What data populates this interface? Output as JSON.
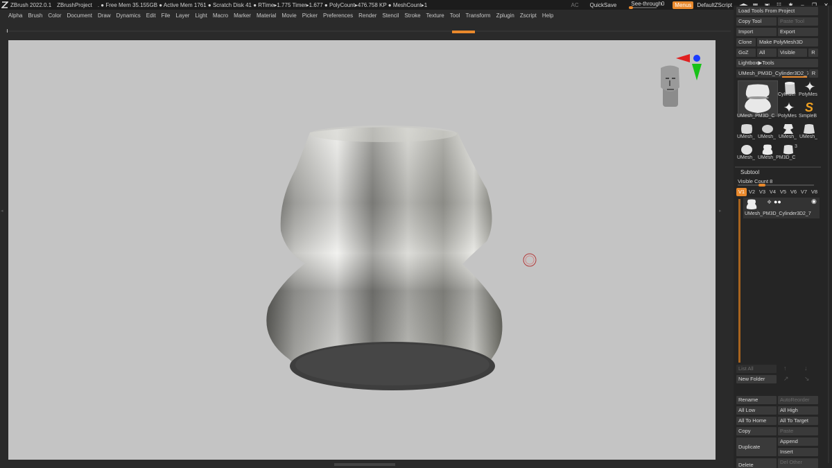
{
  "titlebar": {
    "app": "ZBrush 2022.0.1",
    "project": "ZBrushProject",
    "info": ". ● Free Mem 35.155GB ● Active Mem 1761 ● Scratch Disk 41 ●  RTime▸1.775 Timer▸1.677 ● PolyCount▸476.758 KP  ● MeshCount▸1",
    "ac": "AC",
    "quicksave": "QuickSave",
    "seethrough_label": "See-through",
    "seethrough_value": "0",
    "menus": "Menus",
    "defaultzscript": "DefaultZScript"
  },
  "menubar": {
    "items": [
      "Alpha",
      "Brush",
      "Color",
      "Document",
      "Draw",
      "Dynamics",
      "Edit",
      "File",
      "Layer",
      "Light",
      "Macro",
      "Marker",
      "Material",
      "Movie",
      "Picker",
      "Preferences",
      "Render",
      "Stencil",
      "Stroke",
      "Texture",
      "Tool",
      "Transform",
      "Zplugin",
      "Zscript",
      "Help"
    ]
  },
  "tool_panel": {
    "load_tools": "Load Tools From Project",
    "copy_tool": "Copy Tool",
    "paste_tool": "Paste Tool",
    "import": "Import",
    "export": "Export",
    "clone": "Clone",
    "make_polymesh": "Make PolyMesh3D",
    "goz": "GoZ",
    "all": "All",
    "visible": "Visible",
    "r": "R",
    "lightbox_tools": "Lightbox▶Tools",
    "current_tool": "UMesh_PM3D_Cylinder3D2_7",
    "current_tool_r": "R",
    "thumbs": {
      "big": "UMesh_PM3D_C",
      "cylinder": "Cylinder",
      "polymesh": "PolyMes",
      "polymesh2": "PolyMes",
      "simpleb": "SimpleB",
      "umesh_a": "UMesh_",
      "umesh_b": "UMesh_",
      "umesh_c": "UMesh_",
      "umesh_d": "UMesh_",
      "umesh_e": "UMesh_",
      "umesh_pm3d": "UMesh_PM3D_C",
      "num": "3"
    }
  },
  "subtool": {
    "title": "Subtool",
    "visible_count": "Visible Count 8",
    "visible_count_fraction": 0.3,
    "tabs": [
      "V1",
      "V2",
      "V3",
      "V4",
      "V5",
      "V6",
      "V7",
      "V8"
    ],
    "item_label": "UMesh_PM3D_Cylinder3D2_7",
    "list_all": "List All",
    "new_folder": "New Folder",
    "rename": "Rename",
    "autoreorder": "AutoReorder",
    "all_low": "All Low",
    "all_high": "All High",
    "all_to_home": "All To Home",
    "all_to_target": "All To Target",
    "copy": "Copy",
    "paste": "Paste",
    "duplicate": "Duplicate",
    "append": "Append",
    "insert": "Insert",
    "delete": "Delete",
    "del_other": "Del Other"
  },
  "colors": {
    "accent": "#e9892c",
    "canvas": "#c4c4c4",
    "panel": "#252525"
  }
}
